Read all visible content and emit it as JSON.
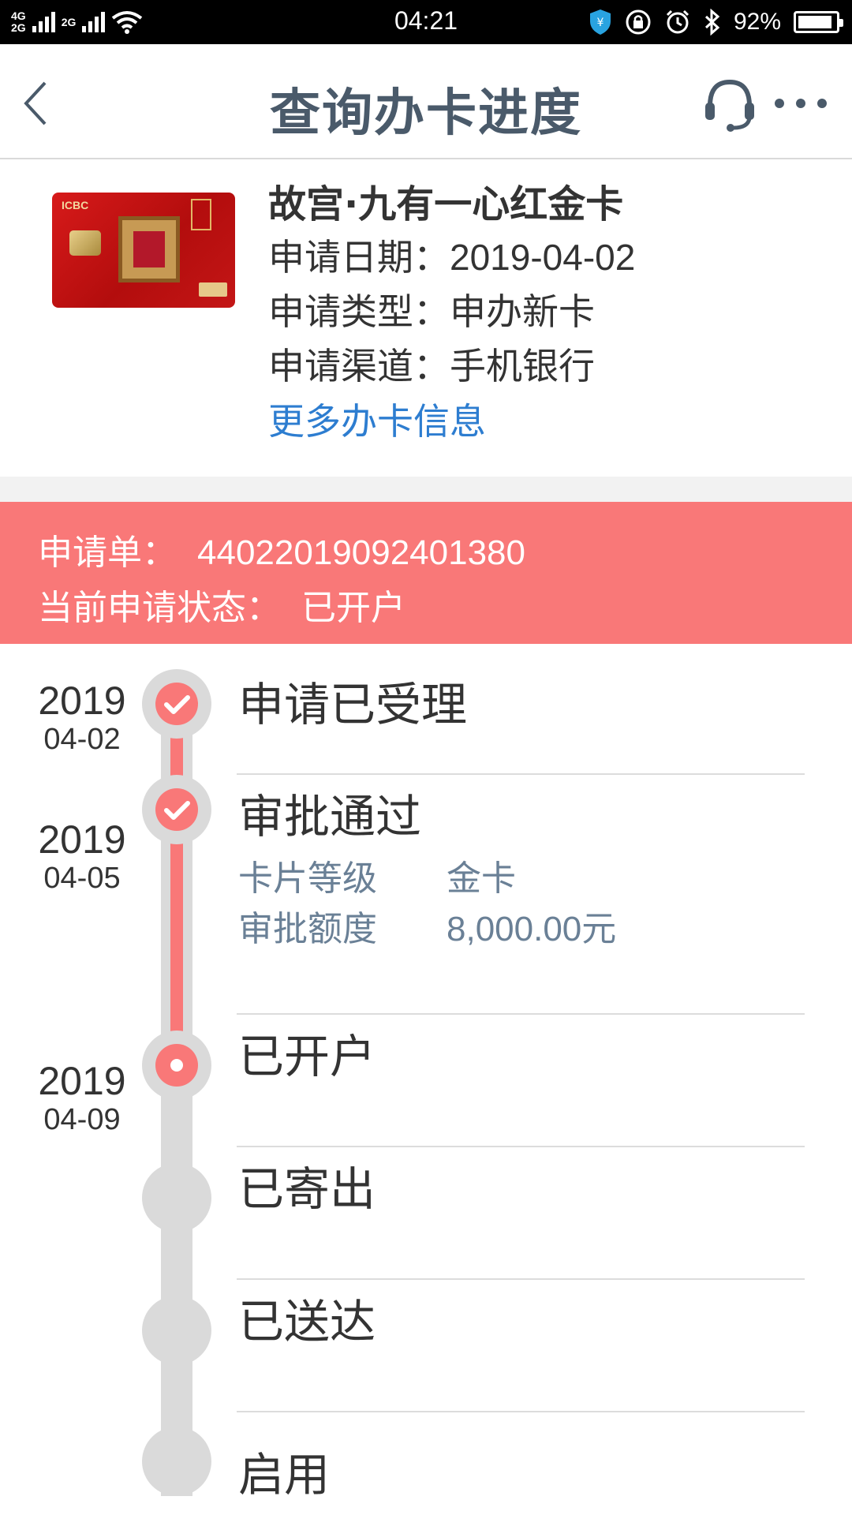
{
  "status_bar": {
    "net_top": "4G",
    "net_bottom": "2G",
    "net_top2": "2G",
    "time": "04:21",
    "battery": "92%",
    "battery_level": 0.92
  },
  "header": {
    "title": "查询办卡进度"
  },
  "card": {
    "name": "故宫·九有一心红金卡",
    "brand_mark": "ICBC",
    "apply_date_label": "申请日期：",
    "apply_date": "2019-04-02",
    "apply_type_label": "申请类型：",
    "apply_type": "申办新卡",
    "apply_channel_label": "申请渠道：",
    "apply_channel": "手机银行",
    "more_link": "更多办卡信息"
  },
  "application": {
    "number_label": "申请单：",
    "number": "44022019092401380",
    "status_label": "当前申请状态：",
    "status": "已开户"
  },
  "steps": [
    {
      "year": "2019",
      "date": "04-02",
      "label": "申请已受理",
      "state": "done"
    },
    {
      "year": "2019",
      "date": "04-05",
      "label": "审批通过",
      "state": "done",
      "details": [
        {
          "key": "卡片等级",
          "value": "金卡"
        },
        {
          "key": "审批额度",
          "value": "8,000.00元"
        }
      ]
    },
    {
      "year": "2019",
      "date": "04-09",
      "label": "已开户",
      "state": "current"
    },
    {
      "year": "",
      "date": "",
      "label": "已寄出",
      "state": "pending"
    },
    {
      "year": "",
      "date": "",
      "label": "已送达",
      "state": "pending"
    },
    {
      "year": "",
      "date": "",
      "label": "启用",
      "state": "pending"
    }
  ],
  "colors": {
    "accent": "#f97878",
    "link": "#2d7dd0",
    "title": "#4a5a6a",
    "track": "#dadada"
  }
}
